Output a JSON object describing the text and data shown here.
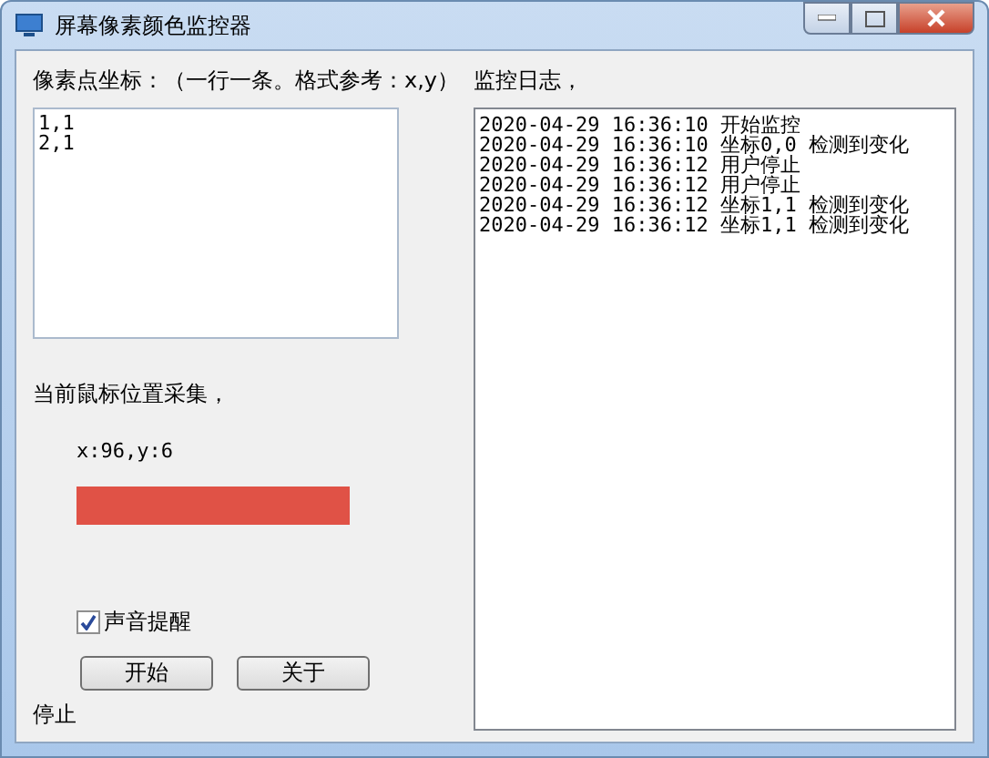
{
  "window": {
    "title": "屏幕像素颜色监控器"
  },
  "coords": {
    "label": "像素点坐标：（一行一条。格式参考：x,y）",
    "value": "1,1\n2,1"
  },
  "mouse": {
    "label": "当前鼠标位置采集，",
    "position": "x:96,y:6",
    "color": "#e05246"
  },
  "sound": {
    "label": "声音提醒",
    "checked": true
  },
  "buttons": [
    "开始",
    "关于"
  ],
  "status": "停止",
  "log": {
    "label": "监控日志，",
    "lines": [
      "2020-04-29 16:36:10 开始监控",
      "2020-04-29 16:36:10 坐标0,0 检测到变化",
      "2020-04-29 16:36:12 用户停止",
      "2020-04-29 16:36:12 用户停止",
      "2020-04-29 16:36:12 坐标1,1 检测到变化",
      "2020-04-29 16:36:12 坐标1,1 检测到变化"
    ]
  }
}
